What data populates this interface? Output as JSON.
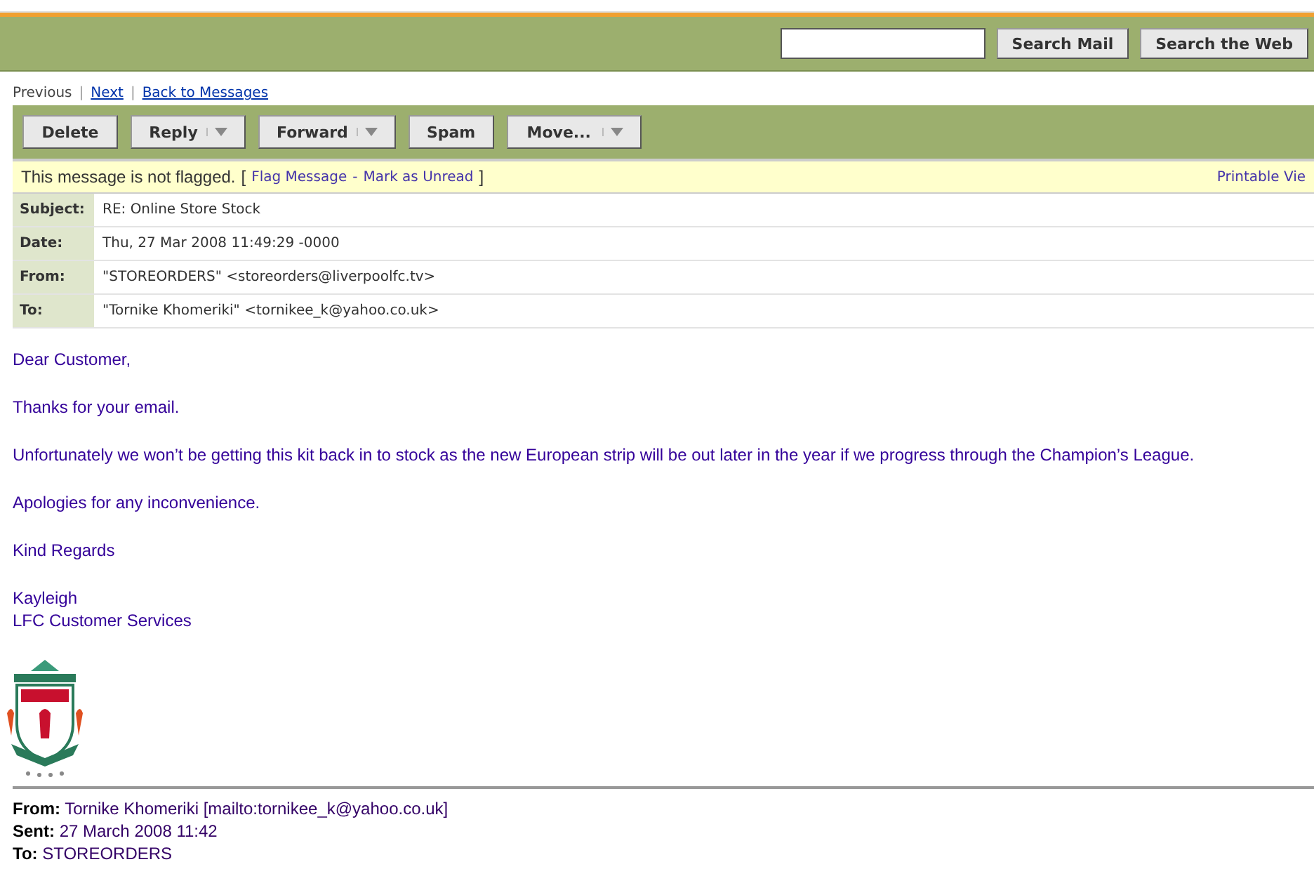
{
  "search": {
    "buttons": [
      "Search Mail",
      "Search the Web"
    ]
  },
  "nav_separator": "|",
  "nav": [
    {
      "label": "Previous",
      "link": false
    },
    {
      "label": "Next",
      "link": true
    },
    {
      "label": "Back to Messages",
      "link": true
    }
  ],
  "toolbar": [
    {
      "label": "Delete",
      "dropdown": false
    },
    {
      "label": "Reply",
      "dropdown": true
    },
    {
      "label": "Forward",
      "dropdown": true
    },
    {
      "label": "Spam",
      "dropdown": false
    },
    {
      "label": "Move...",
      "dropdown": true
    }
  ],
  "flag_bar": {
    "status": "This message is not flagged.",
    "open": "[",
    "actions": [
      "Flag Message",
      "Mark as Unread"
    ],
    "separator": "-",
    "close": "]",
    "printable": "Printable Vie"
  },
  "headers": [
    {
      "label": "Subject:",
      "value": "RE: Online Store Stock"
    },
    {
      "label": "Date:",
      "value": "Thu, 27 Mar 2008 11:49:29 -0000"
    },
    {
      "label": "From:",
      "value": "\"STOREORDERS\" <storeorders@liverpoolfc.tv>"
    },
    {
      "label": "To:",
      "value": "\"Tornike Khomeriki\" <tornikee_k@yahoo.co.uk>"
    }
  ],
  "body": {
    "paragraphs": [
      [
        "Dear Customer,"
      ],
      [
        "Thanks for your email."
      ],
      [
        "Unfortunately we won’t be getting this kit back in to stock as the new European strip will be out later in the year if we progress through the Champion’s League."
      ],
      [
        "Apologies for any inconvenience."
      ],
      [
        "Kind Regards"
      ],
      [
        "Kayleigh",
        "LFC Customer Services"
      ]
    ]
  },
  "quoted": [
    {
      "label": "From:",
      "value": "Tornike Khomeriki [mailto:tornikee_k@yahoo.co.uk]"
    },
    {
      "label": "Sent:",
      "value": "27 March 2008 11:42"
    },
    {
      "label": "To:",
      "value": "STOREORDERS"
    }
  ]
}
